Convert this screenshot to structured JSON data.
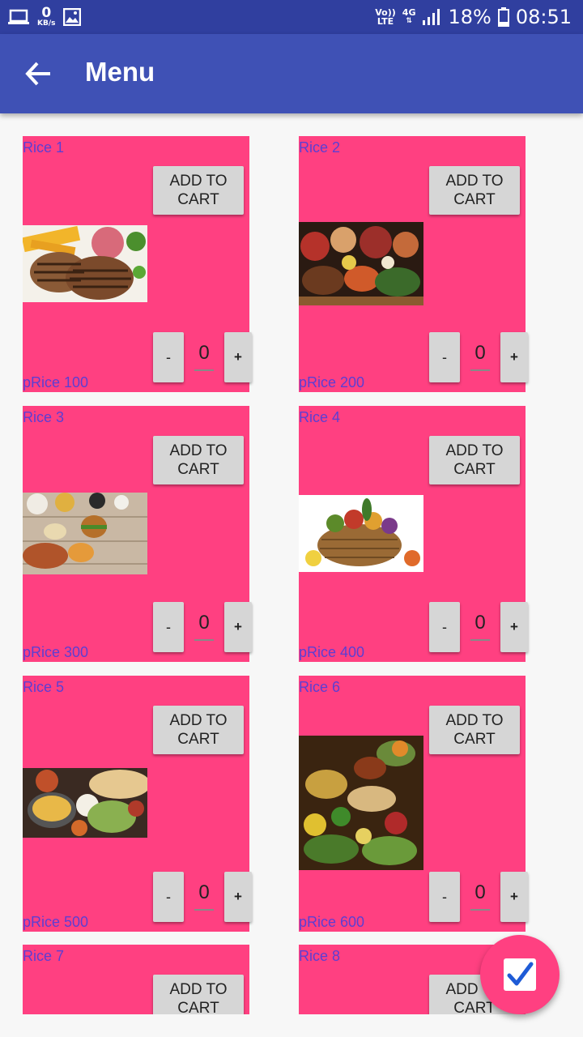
{
  "status_bar": {
    "net_speed_value": "0",
    "net_speed_unit": "KB/s",
    "volte_top": "Vo))",
    "volte_bottom": "LTE",
    "network_type": "4G",
    "battery_percent": "18%",
    "time": "08:51"
  },
  "app_bar": {
    "title": "Menu"
  },
  "products": [
    {
      "name": "Rice 1",
      "price": "pRice 100",
      "add_label": "ADD TO CART",
      "minus": "-",
      "plus": "+",
      "quantity": "0"
    },
    {
      "name": "Rice 2",
      "price": "pRice 200",
      "add_label": "ADD TO CART",
      "minus": "-",
      "plus": "+",
      "quantity": "0"
    },
    {
      "name": "Rice 3",
      "price": "pRice 300",
      "add_label": "ADD TO CART",
      "minus": "-",
      "plus": "+",
      "quantity": "0"
    },
    {
      "name": "Rice 4",
      "price": "pRice 400",
      "add_label": "ADD TO CART",
      "minus": "-",
      "plus": "+",
      "quantity": "0"
    },
    {
      "name": "Rice 5",
      "price": "pRice 500",
      "add_label": "ADD TO CART",
      "minus": "-",
      "plus": "+",
      "quantity": "0"
    },
    {
      "name": "Rice 6",
      "price": "pRice 600",
      "add_label": "ADD TO CART",
      "minus": "-",
      "plus": "+",
      "quantity": "0"
    },
    {
      "name": "Rice 7",
      "add_label": "ADD TO CART"
    },
    {
      "name": "Rice 8",
      "add_label": "ADD TO CART"
    }
  ],
  "fab": {
    "icon": "checkbox-checked-icon"
  },
  "colors": {
    "status_bar": "#303f9f",
    "app_bar": "#3f51b5",
    "card_background": "#ff4081",
    "card_text": "#5c3ed3",
    "button": "#d6d6d6",
    "fab_check": "#1e5bd6"
  }
}
